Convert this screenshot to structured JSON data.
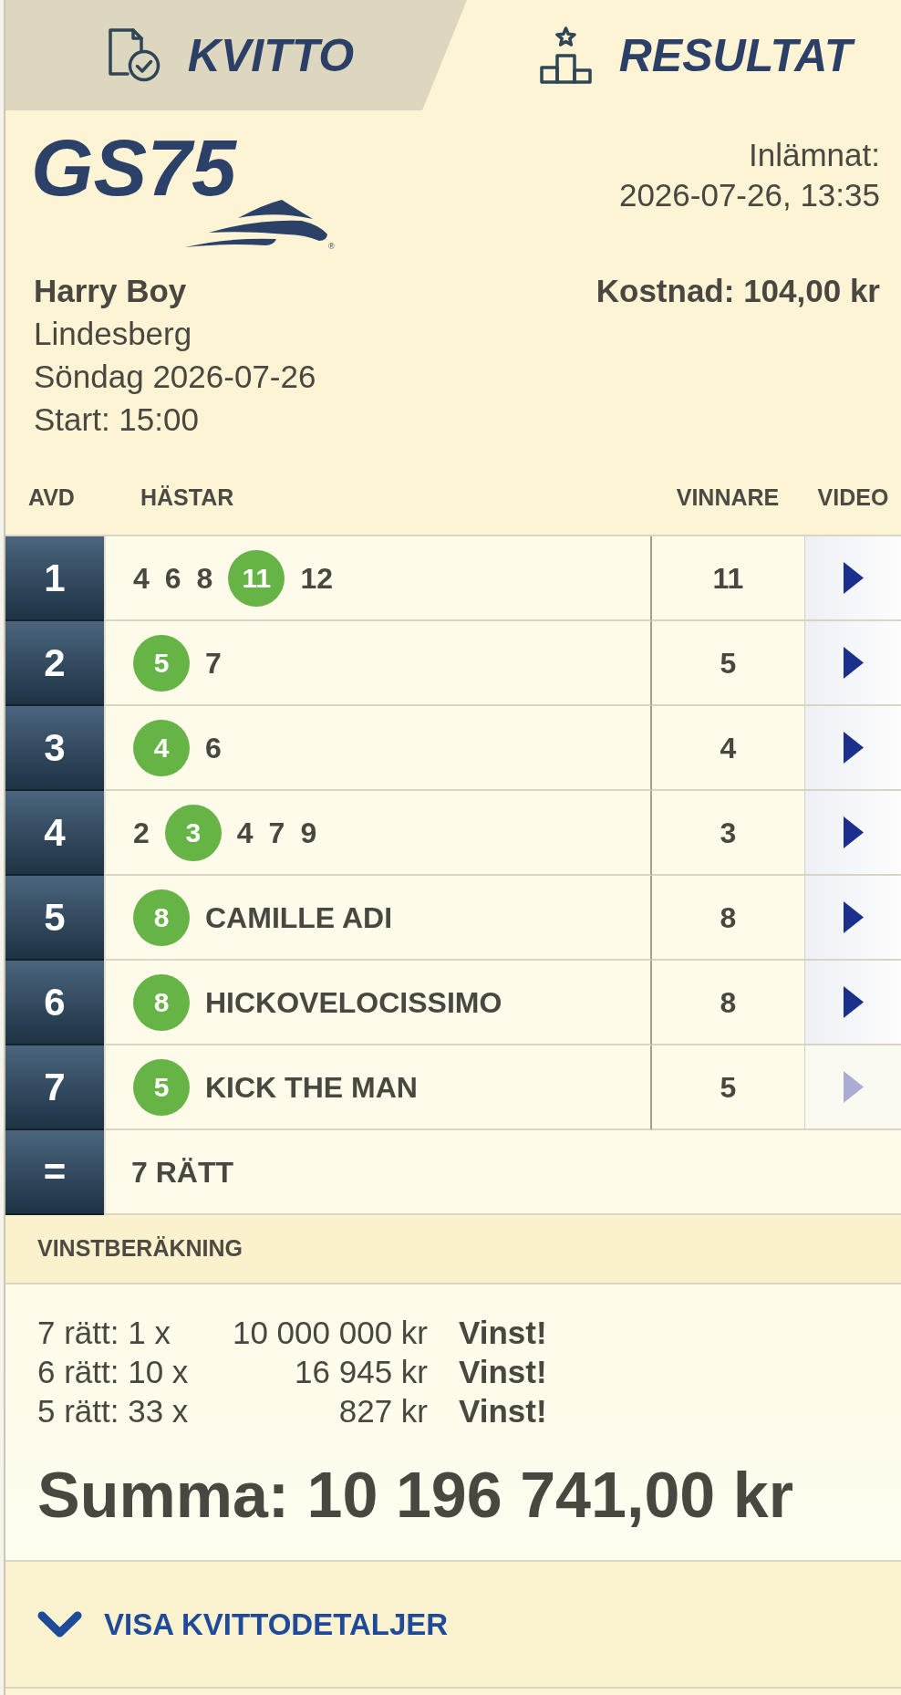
{
  "tabs": [
    {
      "label": "KVITTO",
      "selected": false
    },
    {
      "label": "RESULTAT",
      "selected": true
    }
  ],
  "header": {
    "logo": {
      "text": "GS75",
      "mark": "®"
    },
    "submitted_label": "Inlämnat:",
    "submitted_at": "2026-07-26, 13:35"
  },
  "ticket": {
    "player": "Harry Boy",
    "track": "Lindesberg",
    "date": "Söndag 2026-07-26",
    "start": "Start: 15:00",
    "cost": "Kostnad: 104,00 kr"
  },
  "table": {
    "columns": [
      "AVD",
      "HÄSTAR",
      "VINNARE",
      "VIDEO"
    ],
    "rows": [
      {
        "avd": "1",
        "horses": [
          {
            "number": "4",
            "winner": false
          },
          {
            "number": "6",
            "winner": false
          },
          {
            "number": "8",
            "winner": false
          },
          {
            "number": "11",
            "winner": true
          },
          {
            "number": "12",
            "winner": false
          }
        ],
        "winner": "11",
        "video": {
          "disabled": false
        }
      },
      {
        "avd": "2",
        "horses": [
          {
            "number": "5",
            "winner": true
          },
          {
            "number": "7",
            "winner": false
          }
        ],
        "winner": "5",
        "video": {
          "disabled": false
        }
      },
      {
        "avd": "3",
        "horses": [
          {
            "number": "4",
            "winner": true
          },
          {
            "number": "6",
            "winner": false
          }
        ],
        "winner": "4",
        "video": {
          "disabled": false
        }
      },
      {
        "avd": "4",
        "horses": [
          {
            "number": "2",
            "winner": false
          },
          {
            "number": "3",
            "winner": true
          },
          {
            "number": "4",
            "winner": false
          },
          {
            "number": "7",
            "winner": false
          },
          {
            "number": "9",
            "winner": false
          }
        ],
        "winner": "3",
        "video": {
          "disabled": false
        }
      },
      {
        "avd": "5",
        "horses": [
          {
            "number": "8",
            "winner": true,
            "name": "CAMILLE ADI"
          }
        ],
        "winner": "8",
        "video": {
          "disabled": false
        }
      },
      {
        "avd": "6",
        "horses": [
          {
            "number": "8",
            "winner": true,
            "name": "HICKOVELOCISSIMO"
          }
        ],
        "winner": "8",
        "video": {
          "disabled": false
        }
      },
      {
        "avd": "7",
        "horses": [
          {
            "number": "5",
            "winner": true,
            "name": "KICK THE MAN"
          }
        ],
        "winner": "5",
        "video": {
          "disabled": true
        }
      }
    ],
    "total": {
      "label": "=",
      "result": "7 RÄTT"
    }
  },
  "winnings": {
    "title": "VINSTBERÄKNING",
    "rows": [
      {
        "label": "7 rätt: 1 x",
        "amount": "10 000 000 kr",
        "result": "Vinst!"
      },
      {
        "label": "6 rätt: 10 x",
        "amount": "16 945 kr",
        "result": "Vinst!"
      },
      {
        "label": "5 rätt: 33 x",
        "amount": "827 kr",
        "result": "Vinst!"
      }
    ],
    "sum": "Summa: 10 196 741,00 kr"
  },
  "details_link": {
    "label": "VISA KVITTODETALJER",
    "expanded": false
  }
}
